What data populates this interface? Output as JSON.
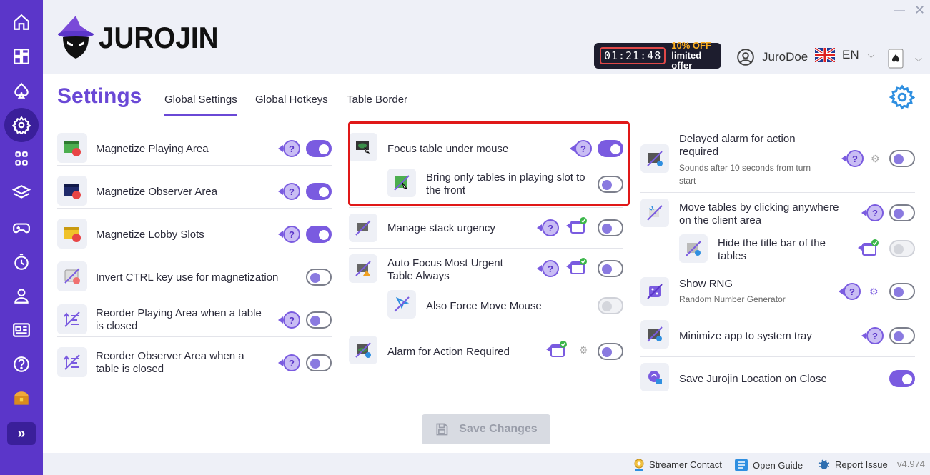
{
  "app": {
    "logo_text": "JUROJIN"
  },
  "header": {
    "timer": "01:21:48",
    "offer_top": "10% OFF",
    "offer_bottom": "limited offer",
    "username": "JuroDoe",
    "language": "EN"
  },
  "page": {
    "title": "Settings",
    "tabs": [
      "Global Settings",
      "Global Hotkeys",
      "Table Border"
    ]
  },
  "col1": [
    {
      "label": "Magnetize Playing Area",
      "toggle": "on"
    },
    {
      "label": "Magnetize Observer Area",
      "toggle": "on"
    },
    {
      "label": "Magnetize Lobby Slots",
      "toggle": "on"
    },
    {
      "label": "Invert CTRL key use for magnetization",
      "toggle": "off"
    },
    {
      "label": "Reorder Playing Area when a table is closed",
      "toggle": "off"
    },
    {
      "label": "Reorder Observer Area when a table is closed",
      "toggle": "off"
    }
  ],
  "col2": {
    "focus_table": "Focus table under mouse",
    "bring_tables": "Bring only tables in playing slot to the front",
    "manage_stack": "Manage stack urgency",
    "auto_focus": "Auto Focus Most Urgent Table Always",
    "force_mouse": "Also Force Move Mouse",
    "alarm": "Alarm for Action Required"
  },
  "col3": {
    "delayed_alarm": "Delayed alarm for action required",
    "delayed_alarm_sub": "Sounds after 10 seconds from turn start",
    "move_tables": "Move tables by clicking anywhere on the client area",
    "hide_title": "Hide the title bar of the tables",
    "show_rng": "Show RNG",
    "show_rng_sub": "Random Number Generator",
    "minimize": "Minimize app to system tray",
    "save_location": "Save Jurojin Location on Close"
  },
  "help_glyph": "?",
  "save_button": "Save Changes",
  "footer": {
    "streamer": "Streamer Contact",
    "guide": "Open Guide",
    "report": "Report Issue",
    "version": "v4.974"
  },
  "colors": {
    "accent": "#7a5be0",
    "sidebar": "#5b36c9",
    "highlight": "#e01818"
  }
}
